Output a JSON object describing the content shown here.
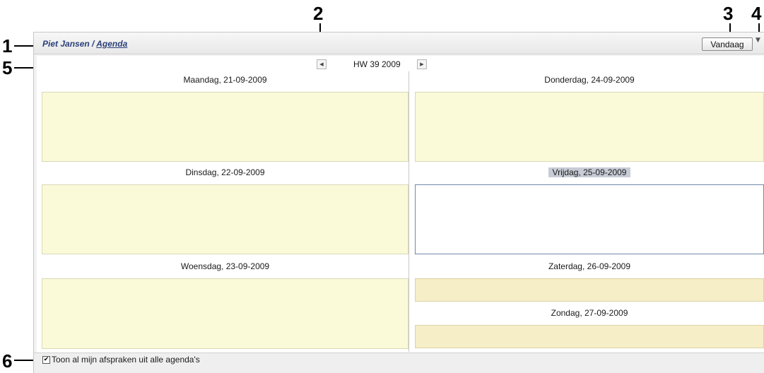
{
  "callouts": [
    "1",
    "2",
    "3",
    "4",
    "5",
    "6"
  ],
  "header": {
    "user_name": "Piet Jansen",
    "separator": " / ",
    "section_link": "Agenda",
    "today_button": "Vandaag",
    "menu_icon": "▼"
  },
  "week_nav": {
    "prev_icon": "◀",
    "label": "HW 39 2009",
    "next_icon": "▶"
  },
  "days": [
    {
      "label": "Maandag, 21-09-2009",
      "state": "normal"
    },
    {
      "label": "Dinsdag, 22-09-2009",
      "state": "normal"
    },
    {
      "label": "Woensdag, 23-09-2009",
      "state": "normal"
    },
    {
      "label": "Donderdag, 24-09-2009",
      "state": "normal"
    },
    {
      "label": "Vrijdag, 25-09-2009",
      "state": "today"
    },
    {
      "label": "Zaterdag, 26-09-2009",
      "state": "weekend"
    },
    {
      "label": "Zondag, 27-09-2009",
      "state": "weekend"
    }
  ],
  "footer": {
    "checkbox_checked": true,
    "checkbox_mark": "✔",
    "checkbox_label": "Toon al mijn afspraken uit alle agenda's"
  },
  "colors": {
    "day_bg": "#fafad8",
    "weekend_bg": "#f6eec6",
    "link": "#2a3f7a"
  }
}
